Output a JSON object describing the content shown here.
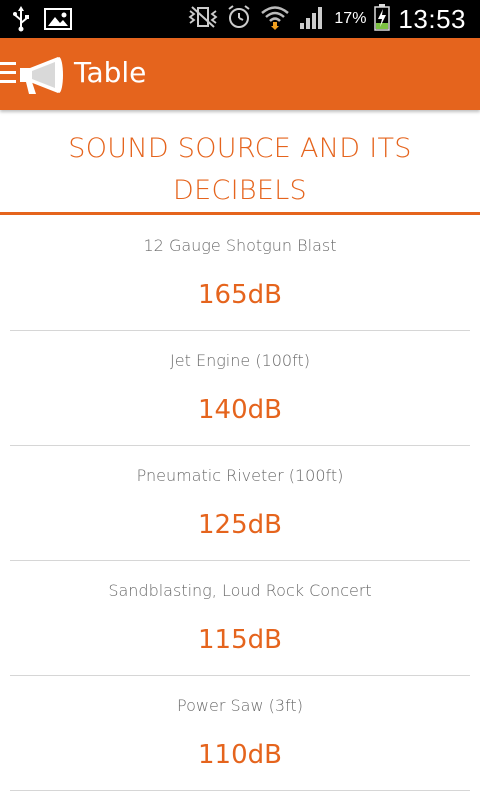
{
  "status_bar": {
    "battery_percent": "17%",
    "time": "13:53",
    "icons": [
      "usb-icon",
      "image-icon",
      "vibrate-icon",
      "alarm-icon",
      "wifi-icon",
      "signal-icon",
      "battery-charging-icon"
    ]
  },
  "app_bar": {
    "title": "Table",
    "menu_icon": "hamburger-menu-icon",
    "logo_icon": "megaphone-icon"
  },
  "table": {
    "heading": "SOUND SOURCE AND ITS DECIBELS",
    "rows": [
      {
        "source": "12 Gauge Shotgun Blast",
        "level": "165dB"
      },
      {
        "source": "Jet Engine (100ft)",
        "level": "140dB"
      },
      {
        "source": "Pneumatic Riveter (100ft)",
        "level": "125dB"
      },
      {
        "source": "Sandblasting, Loud Rock Concert",
        "level": "115dB"
      },
      {
        "source": "Power Saw (3ft)",
        "level": "110dB"
      }
    ]
  },
  "colors": {
    "accent": "#e5641d",
    "text_gray": "#6a6a6a",
    "divider": "#d6d6d6"
  }
}
